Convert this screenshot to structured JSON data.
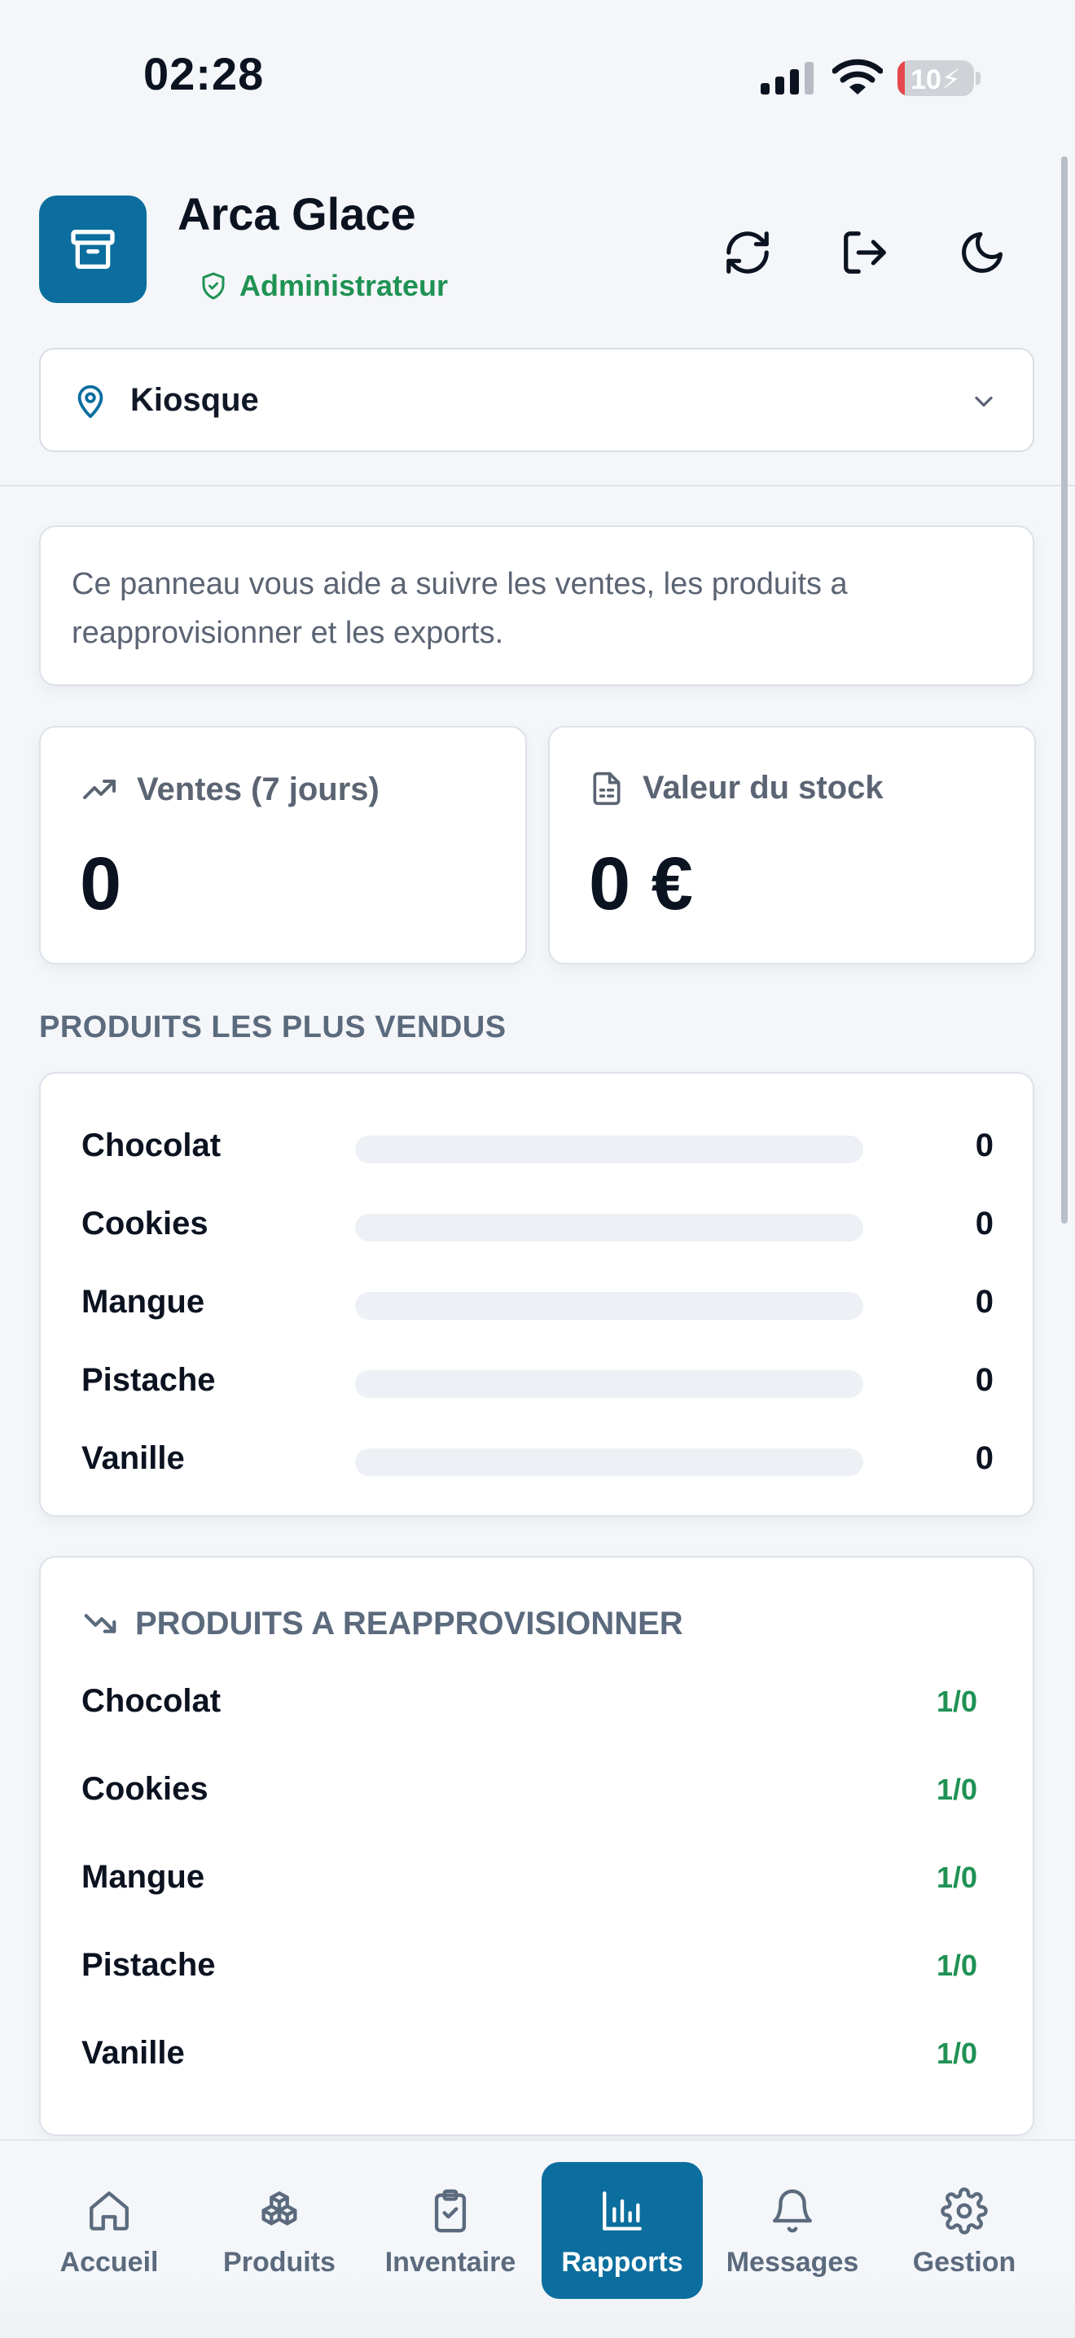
{
  "status_bar": {
    "time": "02:28",
    "battery_text": "10",
    "battery_level": 0.1
  },
  "header": {
    "app_title": "Arca Glace",
    "role_badge": "Administrateur",
    "icons": [
      "archive-icon",
      "refresh-icon",
      "logout-icon",
      "moon-icon"
    ]
  },
  "location": {
    "value": "Kiosque"
  },
  "intro_text": "Ce panneau vous aide a suivre les ventes, les produits a reapprovisionner et les exports.",
  "stats": {
    "sales": {
      "label": "Ventes (7 jours)",
      "value": "0"
    },
    "stock": {
      "label": "Valeur du stock",
      "value": "0 €"
    }
  },
  "top_products": {
    "title": "PRODUITS LES PLUS VENDUS",
    "items": [
      {
        "name": "Chocolat",
        "value": "0",
        "fill": 0
      },
      {
        "name": "Cookies",
        "value": "0",
        "fill": 0
      },
      {
        "name": "Mangue",
        "value": "0",
        "fill": 0
      },
      {
        "name": "Pistache",
        "value": "0",
        "fill": 0
      },
      {
        "name": "Vanille",
        "value": "0",
        "fill": 0
      }
    ]
  },
  "restock": {
    "title": "PRODUITS A REAPPROVISIONNER",
    "items": [
      {
        "name": "Chocolat",
        "ratio": "1/0"
      },
      {
        "name": "Cookies",
        "ratio": "1/0"
      },
      {
        "name": "Mangue",
        "ratio": "1/0"
      },
      {
        "name": "Pistache",
        "ratio": "1/0"
      },
      {
        "name": "Vanille",
        "ratio": "1/0"
      }
    ]
  },
  "nav": {
    "items": [
      {
        "label": "Accueil",
        "icon": "home-icon"
      },
      {
        "label": "Produits",
        "icon": "boxes-icon"
      },
      {
        "label": "Inventaire",
        "icon": "clipboard-check-icon"
      },
      {
        "label": "Rapports",
        "icon": "bar-chart-icon",
        "active": true
      },
      {
        "label": "Messages",
        "icon": "bell-icon"
      },
      {
        "label": "Gestion",
        "icon": "gear-icon"
      }
    ]
  },
  "colors": {
    "primary": "#0b6e9e",
    "success": "#1f9254",
    "muted": "#5b6a7d",
    "battery_low": "#e5484d"
  }
}
